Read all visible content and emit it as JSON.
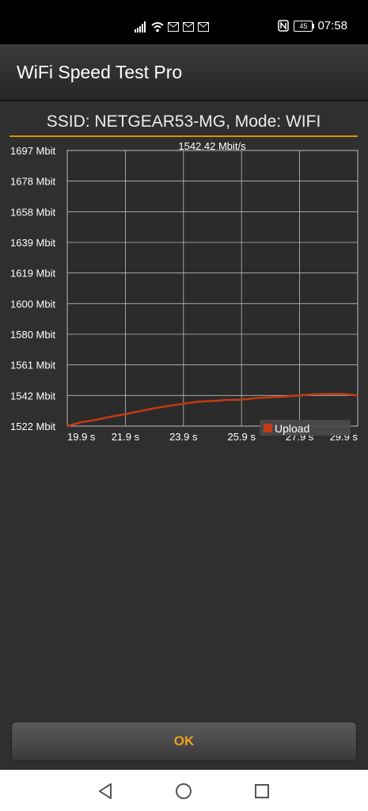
{
  "status_bar": {
    "icons": [
      "signal-icon",
      "wifi-icon",
      "mail-icon",
      "mail-icon",
      "mail-icon",
      "nfc-icon"
    ],
    "battery": "45",
    "time": "07:58"
  },
  "app": {
    "title": "WiFi Speed Test Pro"
  },
  "dialog": {
    "ssid_line": "SSID: NETGEAR53-MG, Mode: WIFI",
    "ok_label": "OK"
  },
  "colors": {
    "accent": "#e09000",
    "series_upload": "#c43a12",
    "grid": "#bdbdbd",
    "ok_text": "#f0a020"
  },
  "chart_data": {
    "type": "line",
    "title": "1542.42 Mbit/s",
    "y_tick_labels": [
      "1697 Mbit",
      "1678 Mbit",
      "1658 Mbit",
      "1639 Mbit",
      "1619 Mbit",
      "1600 Mbit",
      "1580 Mbit",
      "1561 Mbit",
      "1542 Mbit",
      "1522 Mbit"
    ],
    "x_tick_labels": [
      "19.9 s",
      "21.9 s",
      "23.9 s",
      "25.9 s",
      "27.9 s",
      "29.9 s"
    ],
    "ylim": [
      1522,
      1697
    ],
    "xlim": [
      19.9,
      29.9
    ],
    "grid": true,
    "legend_position": "bottom-right",
    "series": [
      {
        "name": "Upload",
        "x": [
          19.9,
          20.4,
          20.9,
          21.4,
          21.9,
          22.4,
          22.9,
          23.4,
          23.9,
          24.4,
          24.9,
          25.4,
          25.9,
          26.4,
          26.9,
          27.4,
          27.9,
          28.4,
          28.9,
          29.4,
          29.9
        ],
        "values": [
          1522.0,
          1524.5,
          1526.0,
          1528.0,
          1529.6,
          1531.5,
          1533.3,
          1534.8,
          1536.3,
          1537.5,
          1538.0,
          1538.6,
          1538.8,
          1539.8,
          1540.3,
          1540.8,
          1541.5,
          1542.2,
          1542.4,
          1542.4,
          1541.5
        ]
      }
    ]
  }
}
